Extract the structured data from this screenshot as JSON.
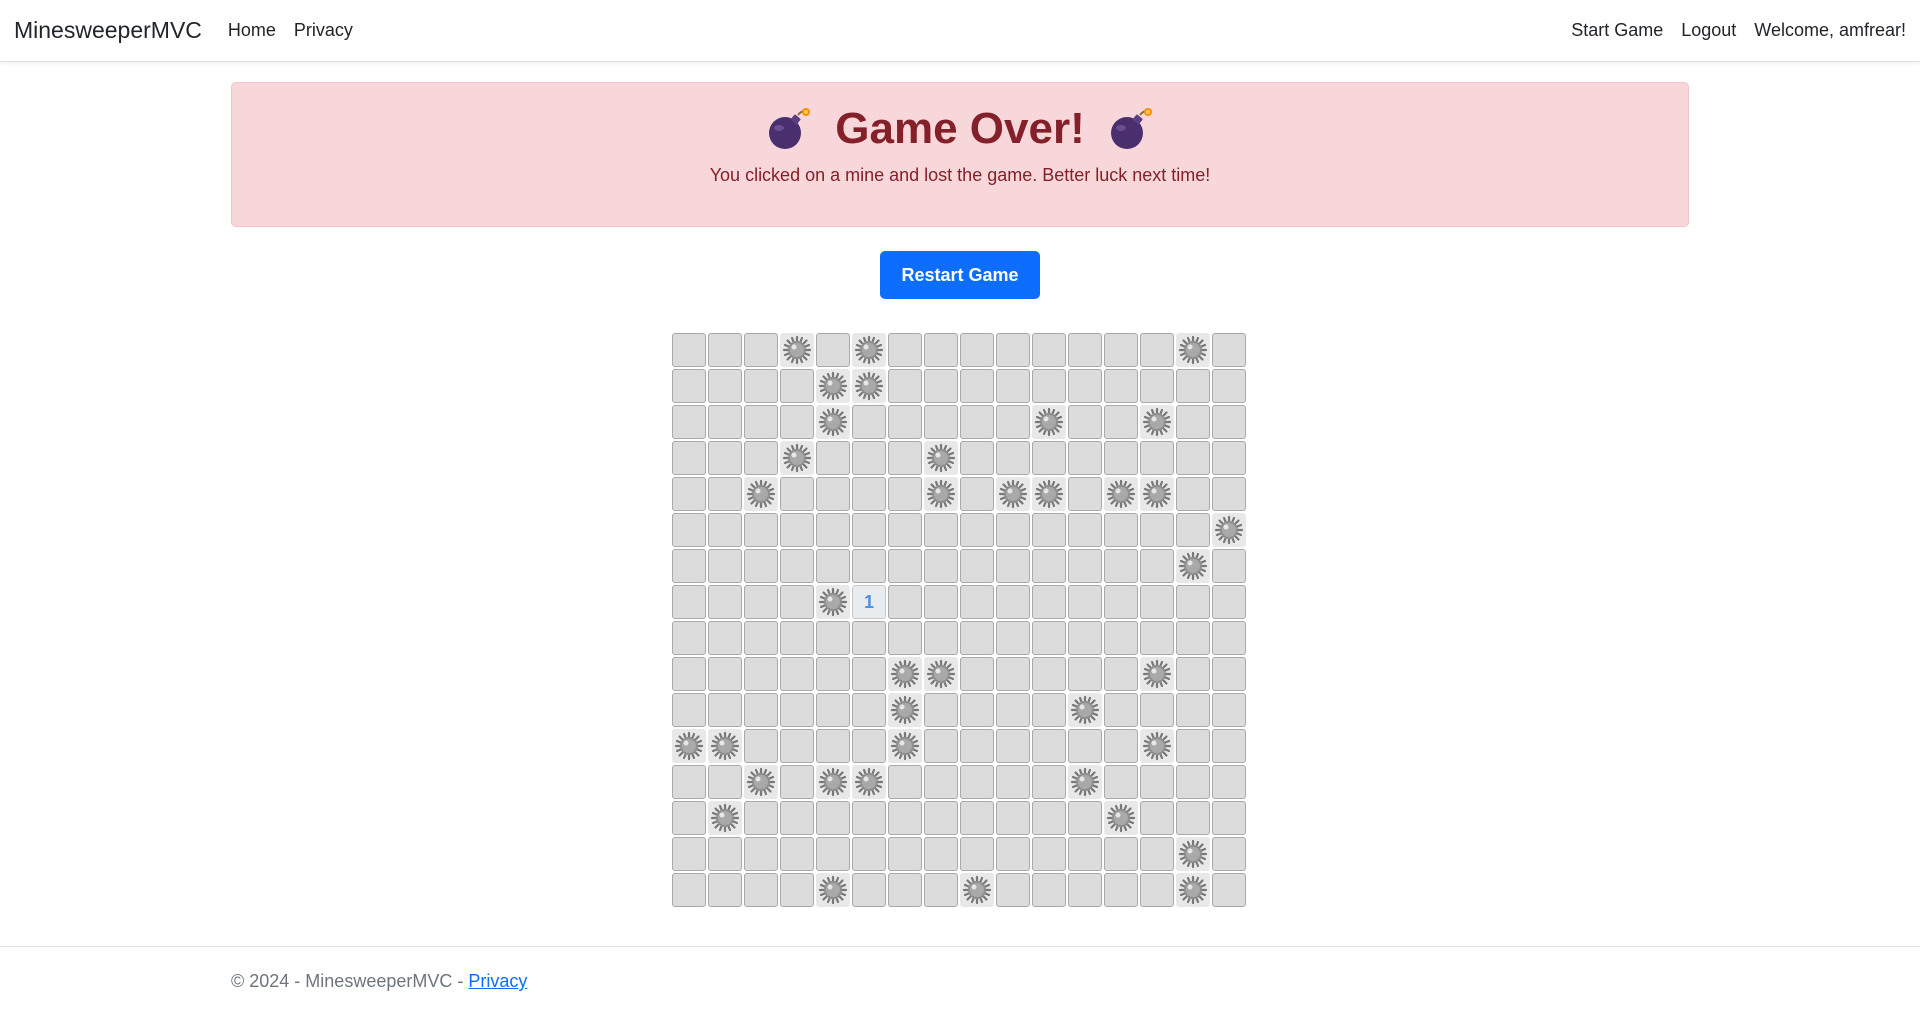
{
  "navbar": {
    "brand": "MinesweeperMVC",
    "links": [
      "Home",
      "Privacy"
    ],
    "start_game": "Start Game",
    "logout": "Logout",
    "welcome": "Welcome, amfrear!"
  },
  "alert": {
    "title": "Game Over!",
    "message": "You clicked on a mine and lost the game. Better luck next time!",
    "icon": "bomb-icon"
  },
  "restart_label": "Restart Game",
  "board": {
    "rows": 16,
    "cols": 16,
    "mine_icon": "mine-icon",
    "grid": [
      "...M.M........M.",
      "....MM..........",
      "....M.....M..M..",
      "...M...M........",
      "..M....M.MM.MM..",
      "...............M",
      "..............M.",
      "....M1..........",
      "................",
      "......MM.....M..",
      "......M....M....",
      "MM....M......M..",
      "..M.MM.....M....",
      ".M..........M...",
      "..............M.",
      "....M...M.....M."
    ]
  },
  "footer": {
    "text": "© 2024 - MinesweeperMVC - ",
    "link": "Privacy"
  }
}
